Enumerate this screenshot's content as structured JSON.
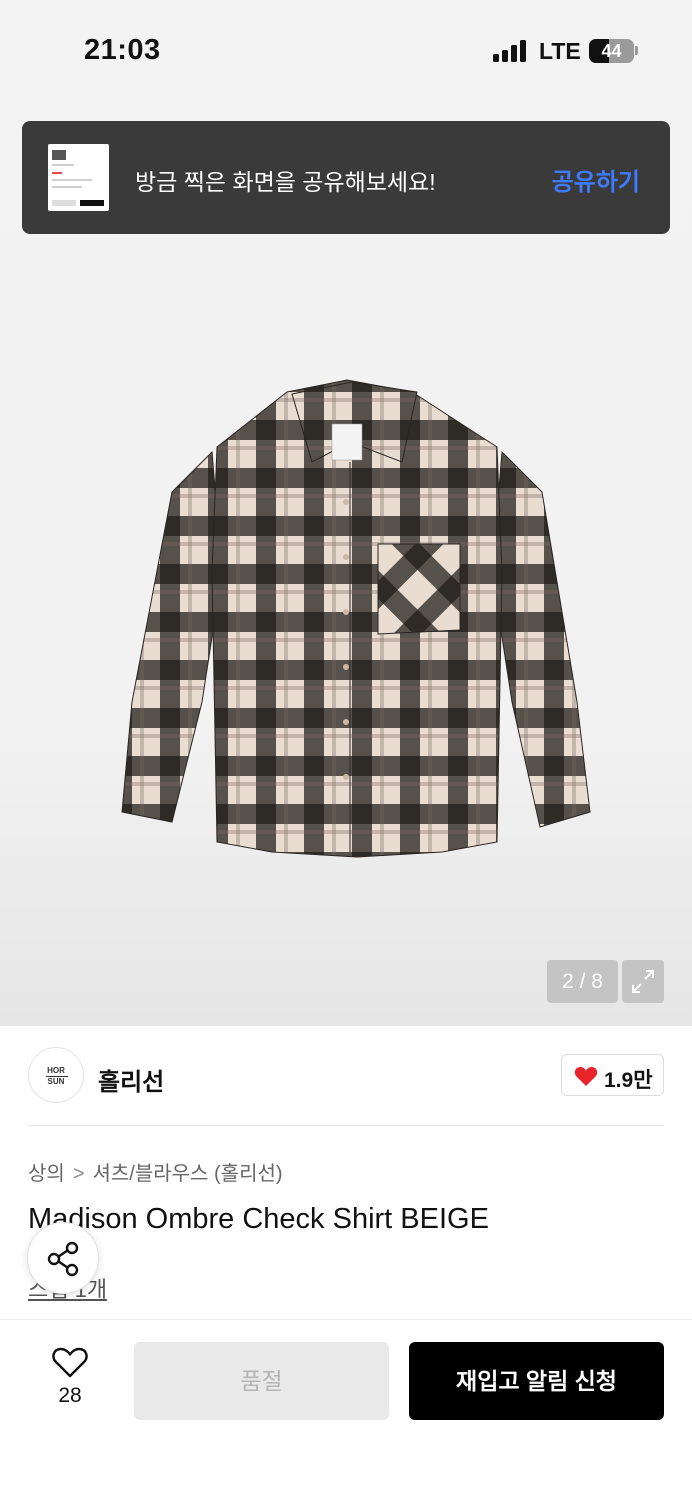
{
  "status_bar": {
    "time": "21:03",
    "network": "LTE",
    "battery": "44",
    "battery_level": 0.44
  },
  "toast": {
    "message": "방금 찍은 화면을 공유해보세요!",
    "action": "공유하기"
  },
  "gallery": {
    "pager": "2 / 8"
  },
  "brand": {
    "logo_line1": "HOR",
    "logo_line2": "SUN",
    "name": "홀리선",
    "likes": "1.9만"
  },
  "breadcrumb": {
    "level1": "상의",
    "separator": ">",
    "level2": "셔츠/블라우스 (홀리선)"
  },
  "product": {
    "title": "Madison Ombre Check Shirt BEIGE",
    "review_link": "스냅 1개"
  },
  "bottom_bar": {
    "wish_count": "28",
    "soldout_label": "품절",
    "restock_label": "재입고 알림 신청"
  },
  "colors": {
    "accent": "#3d7bff",
    "heart": "#e8232a",
    "toast_bg": "#3a3a3a",
    "primary_button": "#000000"
  }
}
